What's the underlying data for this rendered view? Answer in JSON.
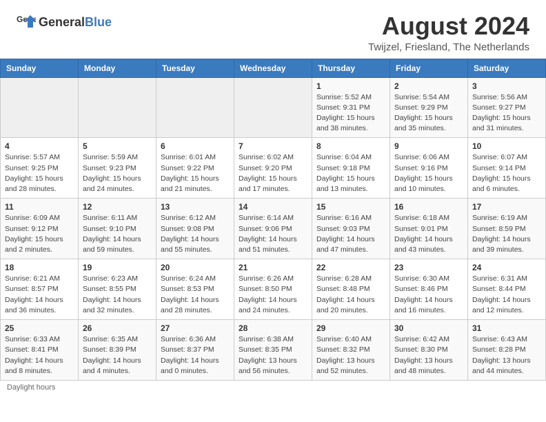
{
  "header": {
    "logo_general": "General",
    "logo_blue": "Blue",
    "month_title": "August 2024",
    "subtitle": "Twijzel, Friesland, The Netherlands"
  },
  "days_of_week": [
    "Sunday",
    "Monday",
    "Tuesday",
    "Wednesday",
    "Thursday",
    "Friday",
    "Saturday"
  ],
  "weeks": [
    [
      {
        "day": "",
        "info": ""
      },
      {
        "day": "",
        "info": ""
      },
      {
        "day": "",
        "info": ""
      },
      {
        "day": "",
        "info": ""
      },
      {
        "day": "1",
        "info": "Sunrise: 5:52 AM\nSunset: 9:31 PM\nDaylight: 15 hours\nand 38 minutes."
      },
      {
        "day": "2",
        "info": "Sunrise: 5:54 AM\nSunset: 9:29 PM\nDaylight: 15 hours\nand 35 minutes."
      },
      {
        "day": "3",
        "info": "Sunrise: 5:56 AM\nSunset: 9:27 PM\nDaylight: 15 hours\nand 31 minutes."
      }
    ],
    [
      {
        "day": "4",
        "info": "Sunrise: 5:57 AM\nSunset: 9:25 PM\nDaylight: 15 hours\nand 28 minutes."
      },
      {
        "day": "5",
        "info": "Sunrise: 5:59 AM\nSunset: 9:23 PM\nDaylight: 15 hours\nand 24 minutes."
      },
      {
        "day": "6",
        "info": "Sunrise: 6:01 AM\nSunset: 9:22 PM\nDaylight: 15 hours\nand 21 minutes."
      },
      {
        "day": "7",
        "info": "Sunrise: 6:02 AM\nSunset: 9:20 PM\nDaylight: 15 hours\nand 17 minutes."
      },
      {
        "day": "8",
        "info": "Sunrise: 6:04 AM\nSunset: 9:18 PM\nDaylight: 15 hours\nand 13 minutes."
      },
      {
        "day": "9",
        "info": "Sunrise: 6:06 AM\nSunset: 9:16 PM\nDaylight: 15 hours\nand 10 minutes."
      },
      {
        "day": "10",
        "info": "Sunrise: 6:07 AM\nSunset: 9:14 PM\nDaylight: 15 hours\nand 6 minutes."
      }
    ],
    [
      {
        "day": "11",
        "info": "Sunrise: 6:09 AM\nSunset: 9:12 PM\nDaylight: 15 hours\nand 2 minutes."
      },
      {
        "day": "12",
        "info": "Sunrise: 6:11 AM\nSunset: 9:10 PM\nDaylight: 14 hours\nand 59 minutes."
      },
      {
        "day": "13",
        "info": "Sunrise: 6:12 AM\nSunset: 9:08 PM\nDaylight: 14 hours\nand 55 minutes."
      },
      {
        "day": "14",
        "info": "Sunrise: 6:14 AM\nSunset: 9:06 PM\nDaylight: 14 hours\nand 51 minutes."
      },
      {
        "day": "15",
        "info": "Sunrise: 6:16 AM\nSunset: 9:03 PM\nDaylight: 14 hours\nand 47 minutes."
      },
      {
        "day": "16",
        "info": "Sunrise: 6:18 AM\nSunset: 9:01 PM\nDaylight: 14 hours\nand 43 minutes."
      },
      {
        "day": "17",
        "info": "Sunrise: 6:19 AM\nSunset: 8:59 PM\nDaylight: 14 hours\nand 39 minutes."
      }
    ],
    [
      {
        "day": "18",
        "info": "Sunrise: 6:21 AM\nSunset: 8:57 PM\nDaylight: 14 hours\nand 36 minutes."
      },
      {
        "day": "19",
        "info": "Sunrise: 6:23 AM\nSunset: 8:55 PM\nDaylight: 14 hours\nand 32 minutes."
      },
      {
        "day": "20",
        "info": "Sunrise: 6:24 AM\nSunset: 8:53 PM\nDaylight: 14 hours\nand 28 minutes."
      },
      {
        "day": "21",
        "info": "Sunrise: 6:26 AM\nSunset: 8:50 PM\nDaylight: 14 hours\nand 24 minutes."
      },
      {
        "day": "22",
        "info": "Sunrise: 6:28 AM\nSunset: 8:48 PM\nDaylight: 14 hours\nand 20 minutes."
      },
      {
        "day": "23",
        "info": "Sunrise: 6:30 AM\nSunset: 8:46 PM\nDaylight: 14 hours\nand 16 minutes."
      },
      {
        "day": "24",
        "info": "Sunrise: 6:31 AM\nSunset: 8:44 PM\nDaylight: 14 hours\nand 12 minutes."
      }
    ],
    [
      {
        "day": "25",
        "info": "Sunrise: 6:33 AM\nSunset: 8:41 PM\nDaylight: 14 hours\nand 8 minutes."
      },
      {
        "day": "26",
        "info": "Sunrise: 6:35 AM\nSunset: 8:39 PM\nDaylight: 14 hours\nand 4 minutes."
      },
      {
        "day": "27",
        "info": "Sunrise: 6:36 AM\nSunset: 8:37 PM\nDaylight: 14 hours\nand 0 minutes."
      },
      {
        "day": "28",
        "info": "Sunrise: 6:38 AM\nSunset: 8:35 PM\nDaylight: 13 hours\nand 56 minutes."
      },
      {
        "day": "29",
        "info": "Sunrise: 6:40 AM\nSunset: 8:32 PM\nDaylight: 13 hours\nand 52 minutes."
      },
      {
        "day": "30",
        "info": "Sunrise: 6:42 AM\nSunset: 8:30 PM\nDaylight: 13 hours\nand 48 minutes."
      },
      {
        "day": "31",
        "info": "Sunrise: 6:43 AM\nSunset: 8:28 PM\nDaylight: 13 hours\nand 44 minutes."
      }
    ]
  ],
  "footer": {
    "note": "Daylight hours"
  }
}
